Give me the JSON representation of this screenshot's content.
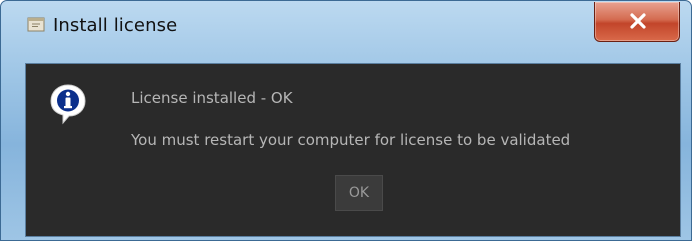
{
  "window": {
    "title": "Install license",
    "title_icon": "application-icon",
    "close_icon": "close-icon"
  },
  "dialog": {
    "icon": "info-icon",
    "message_line1": "License installed - OK",
    "message_line2": "You must restart your computer for license to be validated",
    "ok_label": "OK"
  },
  "colors": {
    "titlebar": "#9fc6e6",
    "close_button": "#c2452a",
    "content_background": "#2a2a2a",
    "message_text": "#b6b6b6"
  }
}
